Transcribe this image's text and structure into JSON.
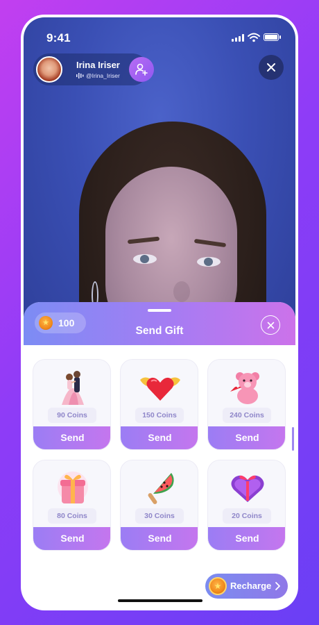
{
  "status_bar": {
    "time": "9:41"
  },
  "profile": {
    "name": "Irina Iriser",
    "handle": "@Irina_Iriser"
  },
  "gift_sheet": {
    "balance": "100",
    "title": "Send Gift",
    "gifts": [
      {
        "icon": "dancing-couple-icon",
        "price": "90 Coins",
        "send_label": "Send"
      },
      {
        "icon": "winged-heart-icon",
        "price": "150 Coins",
        "send_label": "Send"
      },
      {
        "icon": "teddy-bear-icon",
        "price": "240 Coins",
        "send_label": "Send"
      },
      {
        "icon": "gift-box-icon",
        "price": "80 Coins",
        "send_label": "Send"
      },
      {
        "icon": "watermelon-popsicle-icon",
        "price": "30 Coins",
        "send_label": "Send"
      },
      {
        "icon": "heart-chocolate-box-icon",
        "price": "20 Coins",
        "send_label": "Send"
      }
    ],
    "recharge_label": "Recharge"
  },
  "colors": {
    "accent_purple": "#a67cf3",
    "send_gradient_start": "#9b7df4",
    "send_gradient_end": "#c576ee",
    "coin_orange": "#f08a1c",
    "price_text": "#8f86c9"
  }
}
